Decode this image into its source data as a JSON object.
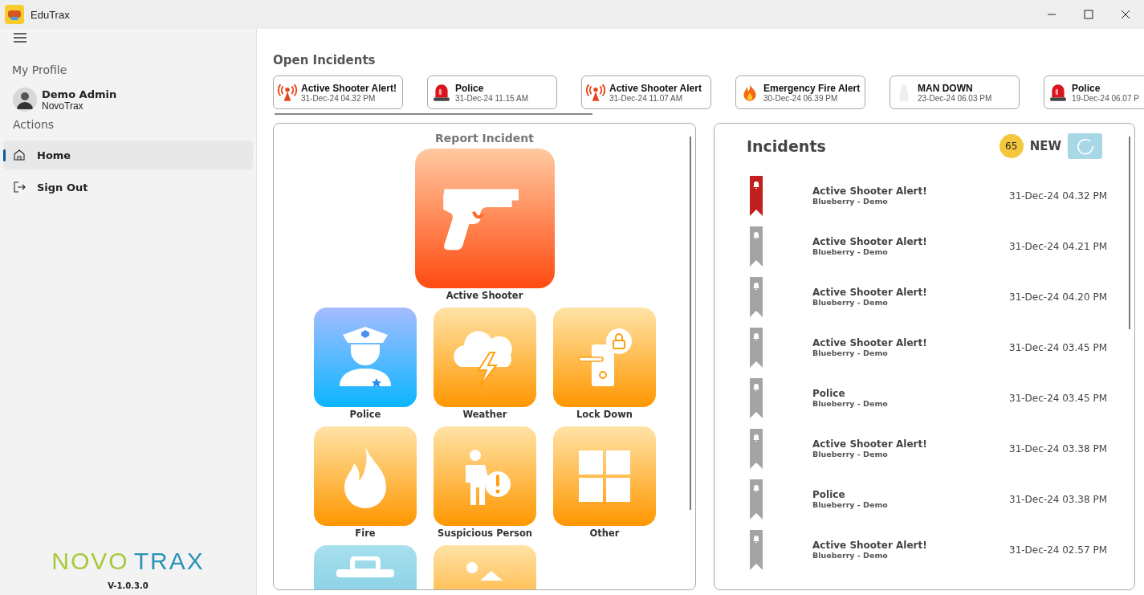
{
  "window": {
    "title": "EduTrax"
  },
  "sidebar": {
    "profile_heading": "My Profile",
    "user": {
      "name": "Demo Admin",
      "org": "NovoTrax"
    },
    "actions_heading": "Actions",
    "items": [
      {
        "label": "Home",
        "kind": "home",
        "selected": true
      },
      {
        "label": "Sign Out",
        "kind": "sign-out",
        "selected": false
      }
    ],
    "logo": {
      "first": "NOVO",
      "second": "TRAX"
    },
    "version": "V-1.0.3.0"
  },
  "open_incidents": {
    "heading": "Open Incidents",
    "items": [
      {
        "title": "Active Shooter Alert!",
        "time": "31-Dec-24 04.32 PM",
        "kind": "beacon"
      },
      {
        "title": "Police",
        "time": "31-Dec-24 11.15 AM",
        "kind": "siren"
      },
      {
        "title": "Active Shooter Alert",
        "time": "31-Dec-24 11.07 AM",
        "kind": "beacon"
      },
      {
        "title": "Emergency Fire Alert",
        "time": "30-Dec-24 06.39 PM",
        "kind": "fire"
      },
      {
        "title": "MAN DOWN",
        "time": "23-Dec-24 06.03 PM",
        "kind": "person"
      },
      {
        "title": "Police",
        "time": "19-Dec-24 06.07 P",
        "kind": "siren"
      }
    ]
  },
  "report": {
    "title": "Report Incident",
    "featured": {
      "label": "Active Shooter",
      "kind": "shooter"
    },
    "tiles": [
      {
        "label": "Police",
        "kind": "police"
      },
      {
        "label": "Weather",
        "kind": "weather"
      },
      {
        "label": "Lock Down",
        "kind": "lockdown"
      },
      {
        "label": "Fire",
        "kind": "fire"
      },
      {
        "label": "Suspicious Person",
        "kind": "suspicious"
      },
      {
        "label": "Other",
        "kind": "other"
      },
      {
        "kind": "medical"
      },
      {
        "kind": "image"
      }
    ]
  },
  "incidents": {
    "title": "Incidents",
    "new_count": "65",
    "new_label": "NEW",
    "rows": [
      {
        "title": "Active Shooter Alert!",
        "site": "Blueberry - Demo",
        "time": "31-Dec-24 04.32 PM",
        "unread": true
      },
      {
        "title": "Active Shooter Alert!",
        "site": "Blueberry - Demo",
        "time": "31-Dec-24 04.21 PM",
        "unread": false
      },
      {
        "title": "Active Shooter Alert!",
        "site": "Blueberry - Demo",
        "time": "31-Dec-24 04.20 PM",
        "unread": false
      },
      {
        "title": "Active Shooter Alert!",
        "site": "Blueberry - Demo",
        "time": "31-Dec-24 03.45 PM",
        "unread": false
      },
      {
        "title": "Police",
        "site": "Blueberry - Demo",
        "time": "31-Dec-24 03.45 PM",
        "unread": false
      },
      {
        "title": "Active Shooter Alert!",
        "site": "Blueberry - Demo",
        "time": "31-Dec-24 03.38 PM",
        "unread": false
      },
      {
        "title": "Police",
        "site": "Blueberry - Demo",
        "time": "31-Dec-24 03.38 PM",
        "unread": false
      },
      {
        "title": "Active Shooter Alert!",
        "site": "Blueberry - Demo",
        "time": "31-Dec-24 02.57 PM",
        "unread": false
      }
    ]
  }
}
